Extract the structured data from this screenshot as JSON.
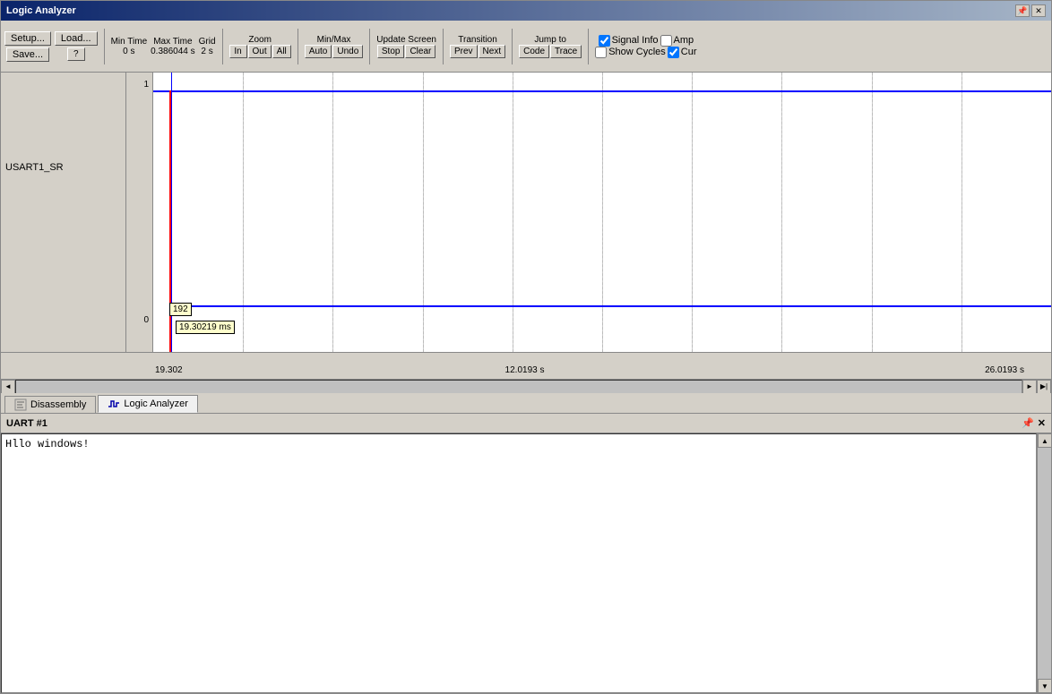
{
  "window": {
    "title": "Logic Analyzer"
  },
  "toolbar": {
    "setup_label": "Setup...",
    "load_label": "Load...",
    "help_label": "?",
    "save_label": "Save...",
    "min_time_label": "Min Time",
    "min_time_value": "0 s",
    "max_time_label": "Max Time",
    "max_time_value": "0.386044 s",
    "grid_label": "Grid",
    "grid_value": "2 s",
    "zoom_label": "Zoom",
    "zoom_in": "In",
    "zoom_out": "Out",
    "zoom_all": "All",
    "minmax_label": "Min/Max",
    "minmax_auto": "Auto",
    "minmax_undo": "Undo",
    "update_screen_label": "Update Screen",
    "update_stop": "Stop",
    "update_clear": "Clear",
    "transition_label": "Transition",
    "transition_prev": "Prev",
    "transition_next": "Next",
    "jump_to_label": "Jump to",
    "jump_code": "Code",
    "jump_trace": "Trace",
    "signal_info_label": "Signal Info",
    "show_cycles_label": "Show Cycles",
    "amp_label": "Amp",
    "cur_label": "Cur"
  },
  "waveform": {
    "signal_name": "USART1_SR",
    "y_high": "1",
    "y_low": "0",
    "cursor_value": "192",
    "cursor_time": "19.30219 ms",
    "time_labels": [
      {
        "x_pct": 0,
        "label": "19.302"
      },
      {
        "x_pct": 50,
        "label": "12.0193 s"
      },
      {
        "x_pct": 95,
        "label": "26.0193 s"
      }
    ]
  },
  "tabs": [
    {
      "id": "disassembly",
      "label": "Disassembly",
      "active": false
    },
    {
      "id": "logic-analyzer",
      "label": "Logic Analyzer",
      "active": true
    }
  ],
  "uart": {
    "title": "UART #1",
    "content": "Hllo windows!"
  },
  "icons": {
    "pin": "📌",
    "close": "✕",
    "scroll_left": "◄",
    "scroll_right": "►",
    "scroll_up": "▲",
    "scroll_down": "▼"
  }
}
